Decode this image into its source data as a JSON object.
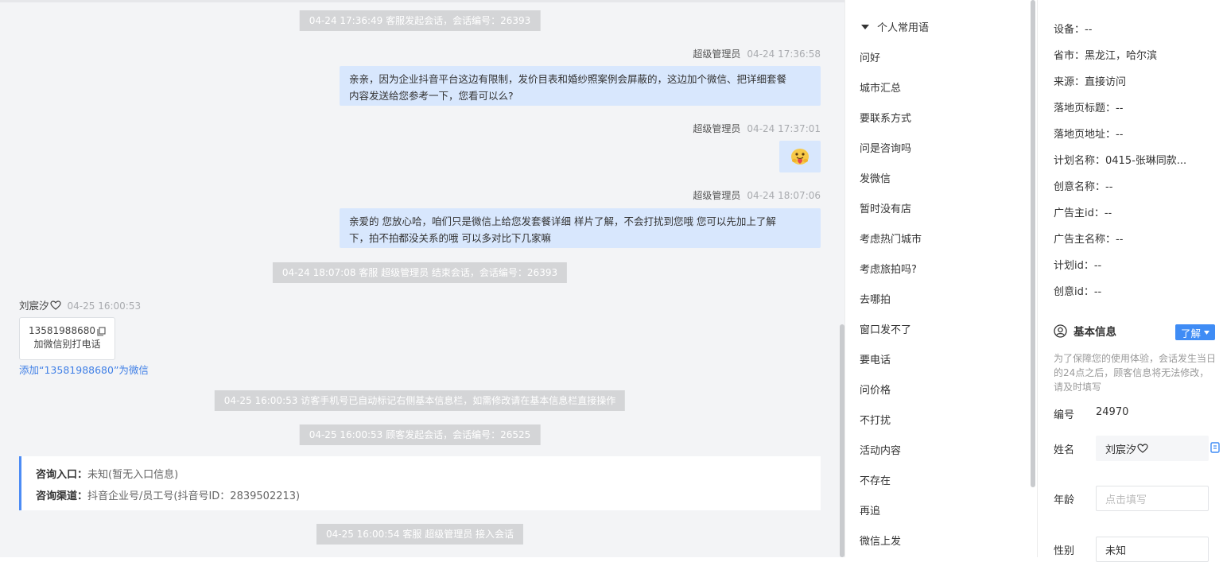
{
  "chat": {
    "system_messages": [
      "04-24 17:36:49 客服发起会话，会话编号：26393",
      "04-24 18:07:08 客服 超级管理员 结束会话，会话编号：26393",
      "04-25 16:00:53 访客手机号已自动标记右侧基本信息栏，如需修改请在基本信息栏直接操作",
      "04-25 16:00:53 顾客发起会话，会话编号：26525",
      "04-25 16:00:54 客服 超级管理员 接入会话"
    ],
    "agent_messages": [
      {
        "sender": "超级管理员",
        "time": "04-24 17:36:58",
        "line1": "亲亲，因为企业抖音平台这边有限制，发价目表和婚纱照案例会屏蔽的，这边加个微信、把详细套餐",
        "line2": "内容发送给您参考一下，您看可以么?"
      },
      {
        "sender": "超级管理员",
        "time": "04-24 17:37:01",
        "emoji": "hug-emoji"
      },
      {
        "sender": "超级管理员",
        "time": "04-24 18:07:06",
        "line1": "亲爱的 您放心哈，咱们只是微信上给您发套餐详细 样片了解，不会打扰到您哦 您可以先加上了解",
        "line2": "下，拍不拍都没关系的哦 可以多对比下几家嘛"
      }
    ],
    "visitor": {
      "name": "刘宸汐",
      "time": "04-25 16:00:53",
      "card_phone": "13581988680",
      "card_text": "加微信别打电话",
      "add_link": "添加“13581988680”为微信"
    },
    "consult": {
      "entry_label": "咨询入口：",
      "entry_value": "未知(暂无入口信息)",
      "channel_label": "咨询渠道：",
      "channel_value": "抖音企业号/员工号(抖音号ID：2839502213)"
    }
  },
  "phrases": {
    "group_title": "个人常用语",
    "items": [
      "问好",
      "城市汇总",
      "要联系方式",
      "问是咨询吗",
      "发微信",
      "暂时没有店",
      "考虑热门城市",
      "考虑旅拍吗?",
      "去哪拍",
      "窗口发不了",
      "要电话",
      "问价格",
      "不打扰",
      "活动内容",
      "不存在",
      "再追",
      "微信上发"
    ]
  },
  "info": {
    "source_rows": [
      "设备：--",
      "省市：黑龙江，哈尔滨",
      "来源：直接访问",
      "落地页标题：--",
      "落地页地址：--",
      "计划名称：0415-张琳同款...",
      "创意名称：--",
      "广告主id：--",
      "广告主名称：--",
      "计划id：--",
      "创意id：--"
    ],
    "basic_title": "基本信息",
    "learn_button": "了解",
    "note": "为了保障您的使用体验，会话发生当日的24点之后，顾客信息将无法修改，请及时填写",
    "id_label": "编号",
    "id_value": "24970",
    "name_label": "姓名",
    "name_value": "刘宸汐",
    "age_label": "年龄",
    "age_placeholder": "点击填写",
    "gender_label": "性别",
    "gender_value": "未知"
  },
  "colors": {
    "accent": "#3f8cf5",
    "bubble": "#d8e7fd",
    "system_pill": "#d4d5d7",
    "link": "#3f7fe6"
  }
}
